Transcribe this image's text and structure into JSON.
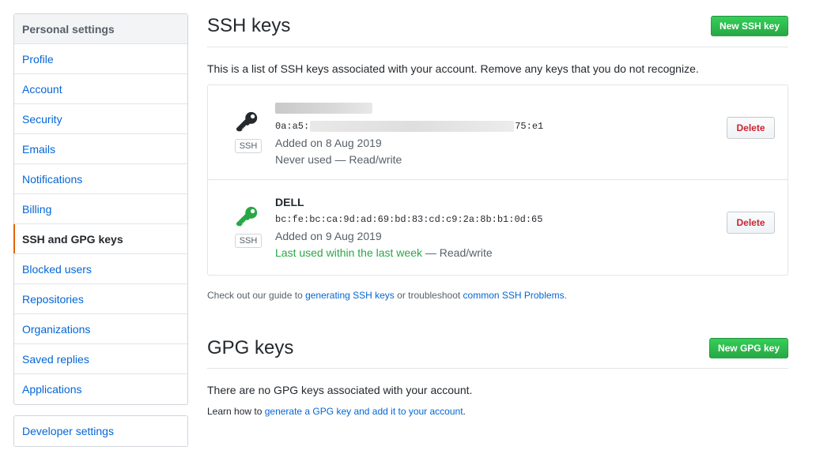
{
  "sidebar": {
    "header": "Personal settings",
    "items": [
      {
        "label": "Profile"
      },
      {
        "label": "Account"
      },
      {
        "label": "Security"
      },
      {
        "label": "Emails"
      },
      {
        "label": "Notifications"
      },
      {
        "label": "Billing"
      },
      {
        "label": "SSH and GPG keys",
        "selected": true
      },
      {
        "label": "Blocked users"
      },
      {
        "label": "Repositories"
      },
      {
        "label": "Organizations"
      },
      {
        "label": "Saved replies"
      },
      {
        "label": "Applications"
      }
    ],
    "developer": "Developer settings"
  },
  "ssh": {
    "title": "SSH keys",
    "new_button": "New SSH key",
    "intro": "This is a list of SSH keys associated with your account. Remove any keys that you do not recognize.",
    "keys": [
      {
        "title": "",
        "fingerprint_start": "0a:a5:",
        "fingerprint_end": "75:e1",
        "badge": "SSH",
        "added": "Added on 8 Aug 2019",
        "usage": "Never used",
        "usage_recent": "",
        "access": "— Read/write",
        "delete_label": "Delete",
        "icon_color": "#24292e"
      },
      {
        "title": "DELL",
        "fingerprint": "bc:fe:bc:ca:9d:ad:69:bd:83:cd:c9:2a:8b:b1:0d:65",
        "badge": "SSH",
        "added": "Added on 9 Aug 2019",
        "usage": "",
        "usage_recent": "Last used within the last week",
        "access": "— Read/write",
        "delete_label": "Delete",
        "icon_color": "#28a745"
      }
    ],
    "footer_prefix": "Check out our guide to ",
    "footer_link1": "generating SSH keys",
    "footer_middle": " or troubleshoot ",
    "footer_link2": "common SSH Problems",
    "footer_suffix": "."
  },
  "gpg": {
    "title": "GPG keys",
    "new_button": "New GPG key",
    "empty": "There are no GPG keys associated with your account.",
    "learn_prefix": "Learn how to ",
    "learn_link": "generate a GPG key and add it to your account",
    "learn_suffix": "."
  },
  "colors": {
    "accent_selected": "#e36209",
    "link": "#0366d6",
    "primary_button": "#28a745",
    "danger_text": "#cb2431"
  }
}
